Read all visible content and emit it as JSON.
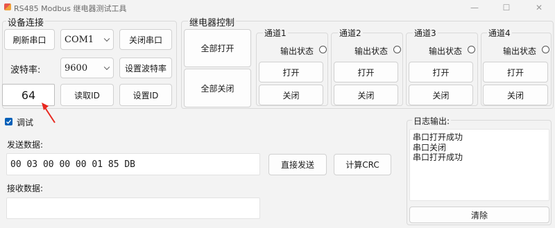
{
  "window": {
    "title": "RS485 Modbus 继电器测试工具",
    "minimize": "—",
    "maximize": "☐",
    "close": "✕"
  },
  "device": {
    "group_title": "设备连接",
    "refresh_port": "刷新串口",
    "port_value": "COM1",
    "close_port": "关闭串口",
    "baud_label": "波特率:",
    "baud_value": "9600",
    "set_baud": "设置波特率",
    "id_value": "64",
    "read_id": "读取ID",
    "set_id": "设置ID"
  },
  "relay": {
    "group_title": "继电器控制",
    "all_on": "全部打开",
    "all_off": "全部关闭",
    "channels": [
      {
        "title": "通道1",
        "status_label": "输出状态",
        "open": "打开",
        "close": "关闭"
      },
      {
        "title": "通道2",
        "status_label": "输出状态",
        "open": "打开",
        "close": "关闭"
      },
      {
        "title": "通道3",
        "status_label": "输出状态",
        "open": "打开",
        "close": "关闭"
      },
      {
        "title": "通道4",
        "status_label": "输出状态",
        "open": "打开",
        "close": "关闭"
      }
    ]
  },
  "debug": {
    "checkbox_label": "调试",
    "checked": true,
    "send_label": "发送数据:",
    "send_value": "00 03 00 00 00 01 85 DB",
    "send_direct": "直接发送",
    "calc_crc": "计算CRC",
    "recv_label": "接收数据:",
    "recv_value": ""
  },
  "log": {
    "group_title": "日志输出:",
    "lines": [
      "串口打开成功",
      "串口关闭",
      "串口打开成功"
    ],
    "clear": "清除"
  },
  "colors": {
    "accent": "#005fb8",
    "annotation_arrow": "#e8281f"
  }
}
